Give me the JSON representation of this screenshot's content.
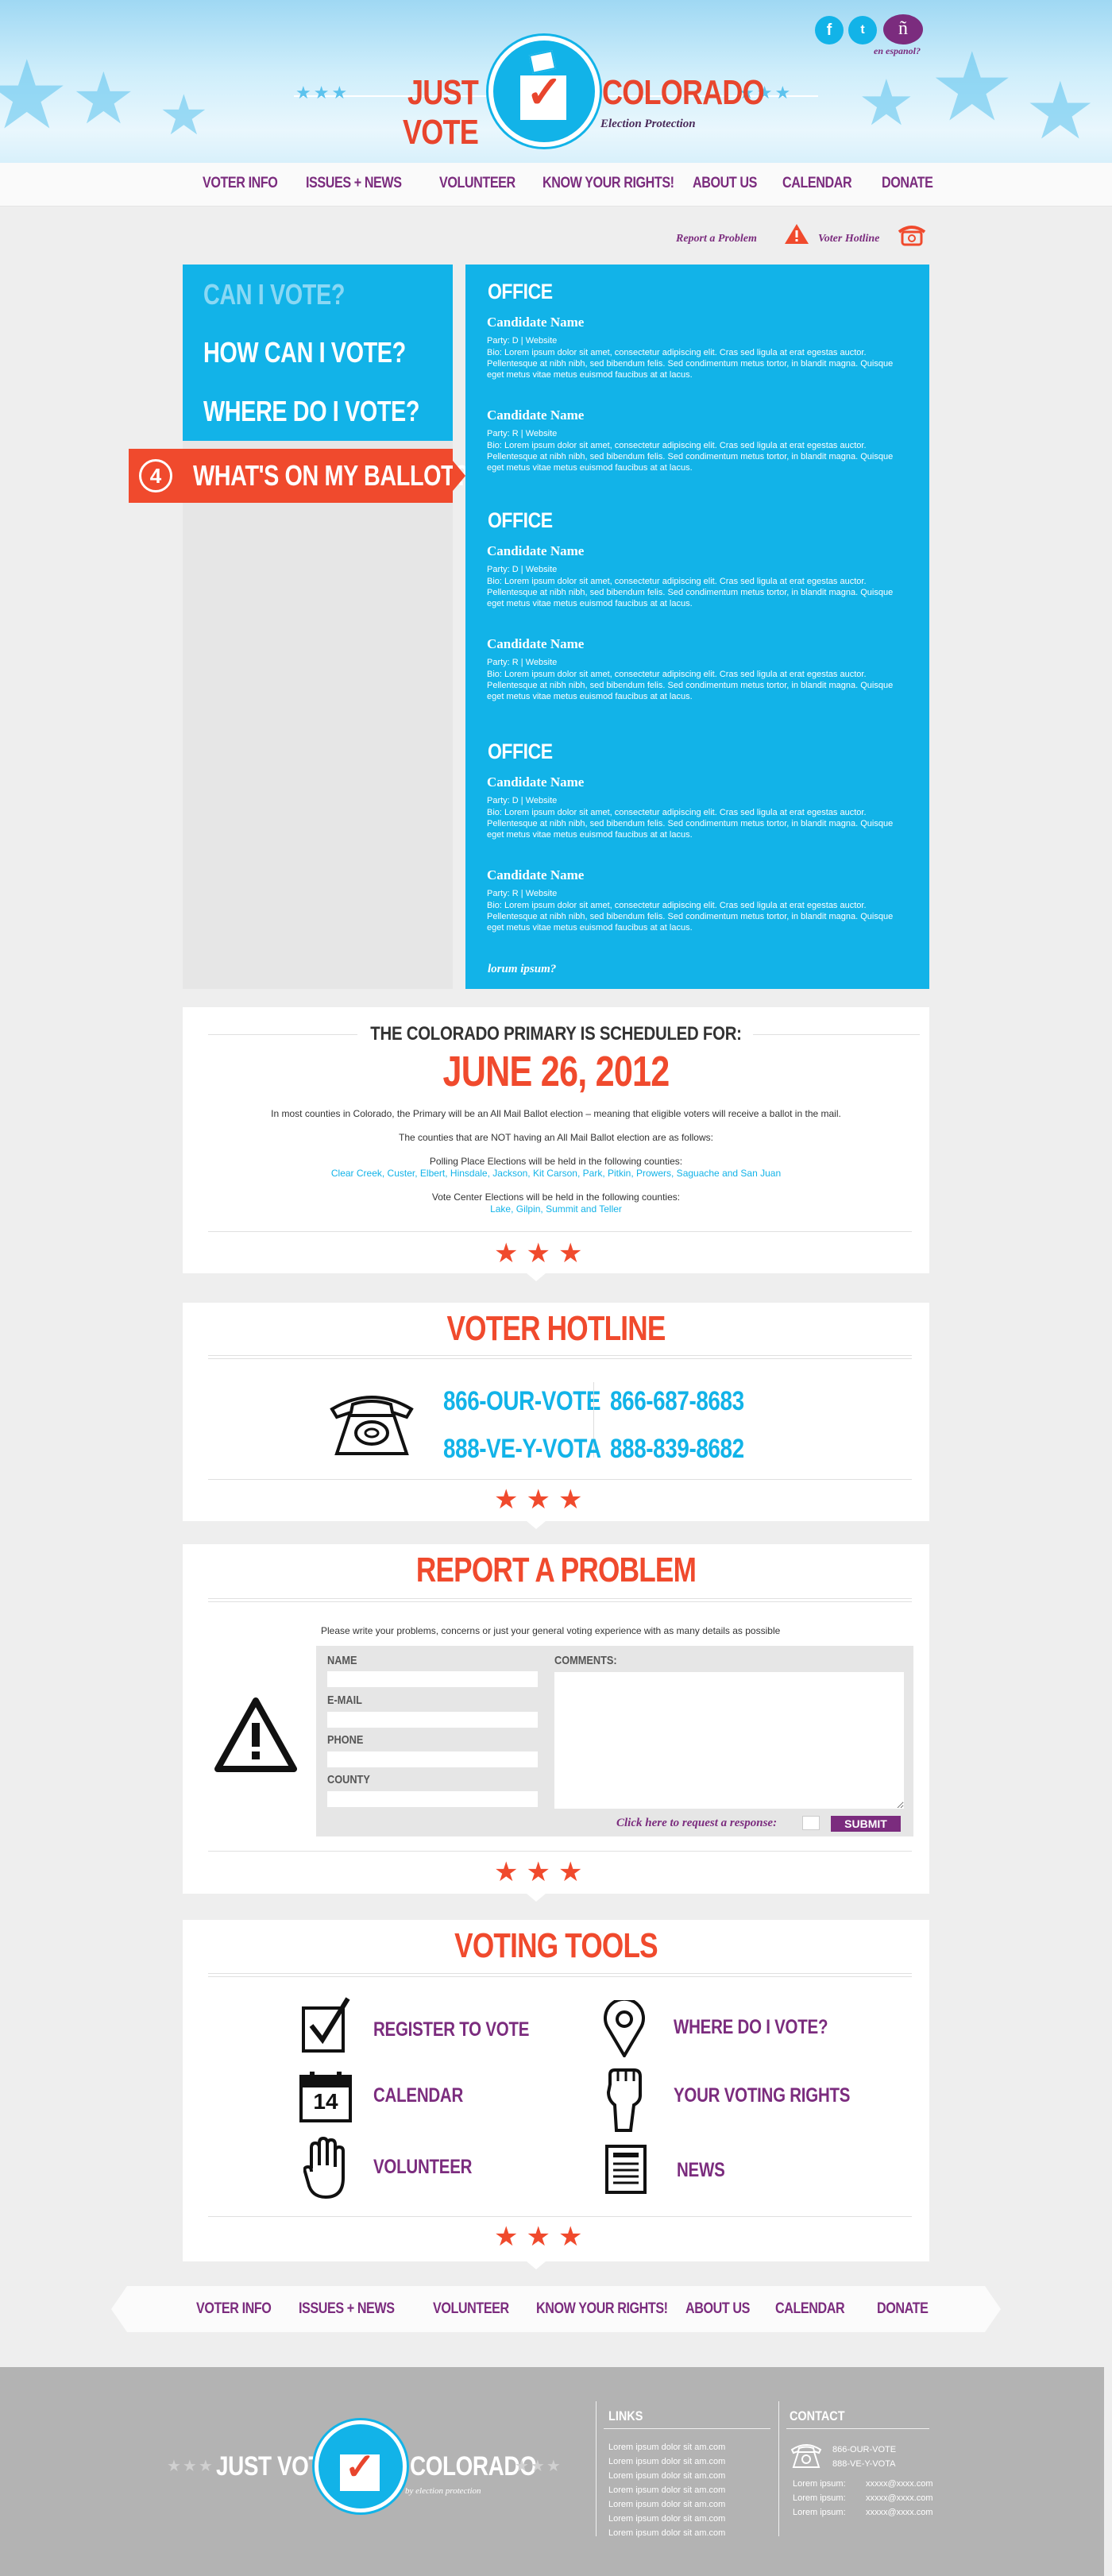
{
  "header": {
    "logo_left": "JUST VOTE",
    "logo_right": "COLORADO",
    "logo_sub": "Election Protection",
    "espanol_link": "en espanol?",
    "social": [
      "facebook-icon",
      "twitter-icon",
      "espanol-icon"
    ]
  },
  "nav": {
    "items": [
      "VOTER INFO",
      "ISSUES + NEWS",
      "VOLUNTEER",
      "KNOW YOUR RIGHTS!",
      "ABOUT US",
      "CALENDAR",
      "DONATE"
    ]
  },
  "utility": {
    "report": "Report a Problem",
    "hotline": "Voter Hotline"
  },
  "left_menu": {
    "items": [
      "CAN I VOTE?",
      "HOW CAN I VOTE?",
      "WHERE DO I VOTE?",
      "WHAT'S ON MY BALLOT?"
    ],
    "active_number": "4"
  },
  "ballot": {
    "offices": [
      {
        "title": "OFFICE",
        "candidates": [
          {
            "name": "Candidate Name",
            "party": "Party: D | Website",
            "bio": "Bio: Lorem ipsum dolor sit amet, consectetur adipiscing elit. Cras sed ligula at erat egestas auctor. Pellentesque at nibh nibh, sed bibendum felis. Sed condimentum metus tortor, in blandit magna. Quisque eget metus vitae metus euismod faucibus at at lacus."
          },
          {
            "name": "Candidate Name",
            "party": "Party: R | Website",
            "bio": "Bio: Lorem ipsum dolor sit amet, consectetur adipiscing elit. Cras sed ligula at erat egestas auctor. Pellentesque at nibh nibh, sed bibendum felis. Sed condimentum metus tortor, in blandit magna. Quisque eget metus vitae metus euismod faucibus at at lacus."
          }
        ]
      },
      {
        "title": "OFFICE",
        "candidates": [
          {
            "name": "Candidate Name",
            "party": "Party: D | Website",
            "bio": "Bio: Lorem ipsum dolor sit amet, consectetur adipiscing elit. Cras sed ligula at erat egestas auctor. Pellentesque at nibh nibh, sed bibendum felis. Sed condimentum metus tortor, in blandit magna. Quisque eget metus vitae metus euismod faucibus at at lacus."
          },
          {
            "name": "Candidate Name",
            "party": "Party: R | Website",
            "bio": "Bio: Lorem ipsum dolor sit amet, consectetur adipiscing elit. Cras sed ligula at erat egestas auctor. Pellentesque at nibh nibh, sed bibendum felis. Sed condimentum metus tortor, in blandit magna. Quisque eget metus vitae metus euismod faucibus at at lacus."
          }
        ]
      },
      {
        "title": "OFFICE",
        "candidates": [
          {
            "name": "Candidate Name",
            "party": "Party: D | Website",
            "bio": "Bio: Lorem ipsum dolor sit amet, consectetur adipiscing elit. Cras sed ligula at erat egestas auctor. Pellentesque at nibh nibh, sed bibendum felis. Sed condimentum metus tortor, in blandit magna. Quisque eget metus vitae metus euismod faucibus at at lacus."
          },
          {
            "name": "Candidate Name",
            "party": "Party: R | Website",
            "bio": "Bio: Lorem ipsum dolor sit amet, consectetur adipiscing elit. Cras sed ligula at erat egestas auctor. Pellentesque at nibh nibh, sed bibendum felis. Sed condimentum metus tortor, in blandit magna. Quisque eget metus vitae metus euismod faucibus at at lacus."
          }
        ]
      }
    ],
    "more_link": "lorum ipsum?"
  },
  "schedule": {
    "title": "THE COLORADO PRIMARY IS SCHEDULED FOR:",
    "date": "JUNE 26, 2012",
    "p1": "In most counties in Colorado, the Primary will be an All Mail Ballot election – meaning that eligible voters will receive a ballot in the mail.",
    "p2": "The counties that are NOT having an All Mail Ballot election are as follows:",
    "p3": "Polling Place Elections will be held in the following counties:",
    "p3_counties": "Clear Creek, Custer, Elbert, Hinsdale, Jackson, Kit Carson, Park, Pitkin, Prowers, Saguache and San Juan",
    "p4": "Vote Center Elections will be held in the following counties:",
    "p4_counties": "Lake, Gilpin, Summit and Teller"
  },
  "hotline": {
    "title": "VOTER HOTLINE",
    "num1": "866-OUR-VOTE",
    "num2": "866-687-8683",
    "num3": "888-VE-Y-VOTA",
    "num4": "888-839-8682"
  },
  "report": {
    "title": "REPORT A PROBLEM",
    "intro": "Please write your problems, concerns or just your general voting experience with as many details as possible",
    "name_label": "NAME",
    "email_label": "E-MAIL",
    "phone_label": "PHONE",
    "county_label": "COUNTY",
    "comments_label": "COMMENTS:",
    "response_prompt": "Click here to request a response:",
    "submit": "SUBMIT"
  },
  "tools": {
    "title": "VOTING TOOLS",
    "register": "REGISTER TO VOTE",
    "where": "WHERE DO I VOTE?",
    "calendar": "CALENDAR",
    "calendar_day": "14",
    "rights": "YOUR VOTING RIGHTS",
    "volunteer": "VOLUNTEER",
    "news": "NEWS"
  },
  "footer": {
    "logo_left": "JUST VOTE",
    "logo_right": "COLORADO",
    "logo_sub": "by election protection",
    "links_title": "LINKS",
    "links": [
      "Lorem ipsum dolor sit am.com",
      "Lorem ipsum dolor sit am.com",
      "Lorem ipsum dolor sit am.com",
      "Lorem ipsum dolor sit am.com",
      "Lorem ipsum dolor sit am.com",
      "Lorem ipsum dolor sit am.com",
      "Lorem ipsum dolor sit am.com"
    ],
    "contact_title": "CONTACT",
    "phone1": "866-OUR-VOTE",
    "phone2": "888-VE-Y-VOTA",
    "contacts": [
      {
        "label": "Lorem ipsum:",
        "value": "xxxxx@xxxx.com"
      },
      {
        "label": "Lorem ipsum:",
        "value": "xxxxx@xxxx.com"
      },
      {
        "label": "Lorem ipsum:",
        "value": "xxxxx@xxxx.com"
      }
    ]
  },
  "colors": {
    "accent_blue": "#12b3e8",
    "accent_red": "#f04a2d",
    "accent_purple": "#7b2c7e"
  }
}
